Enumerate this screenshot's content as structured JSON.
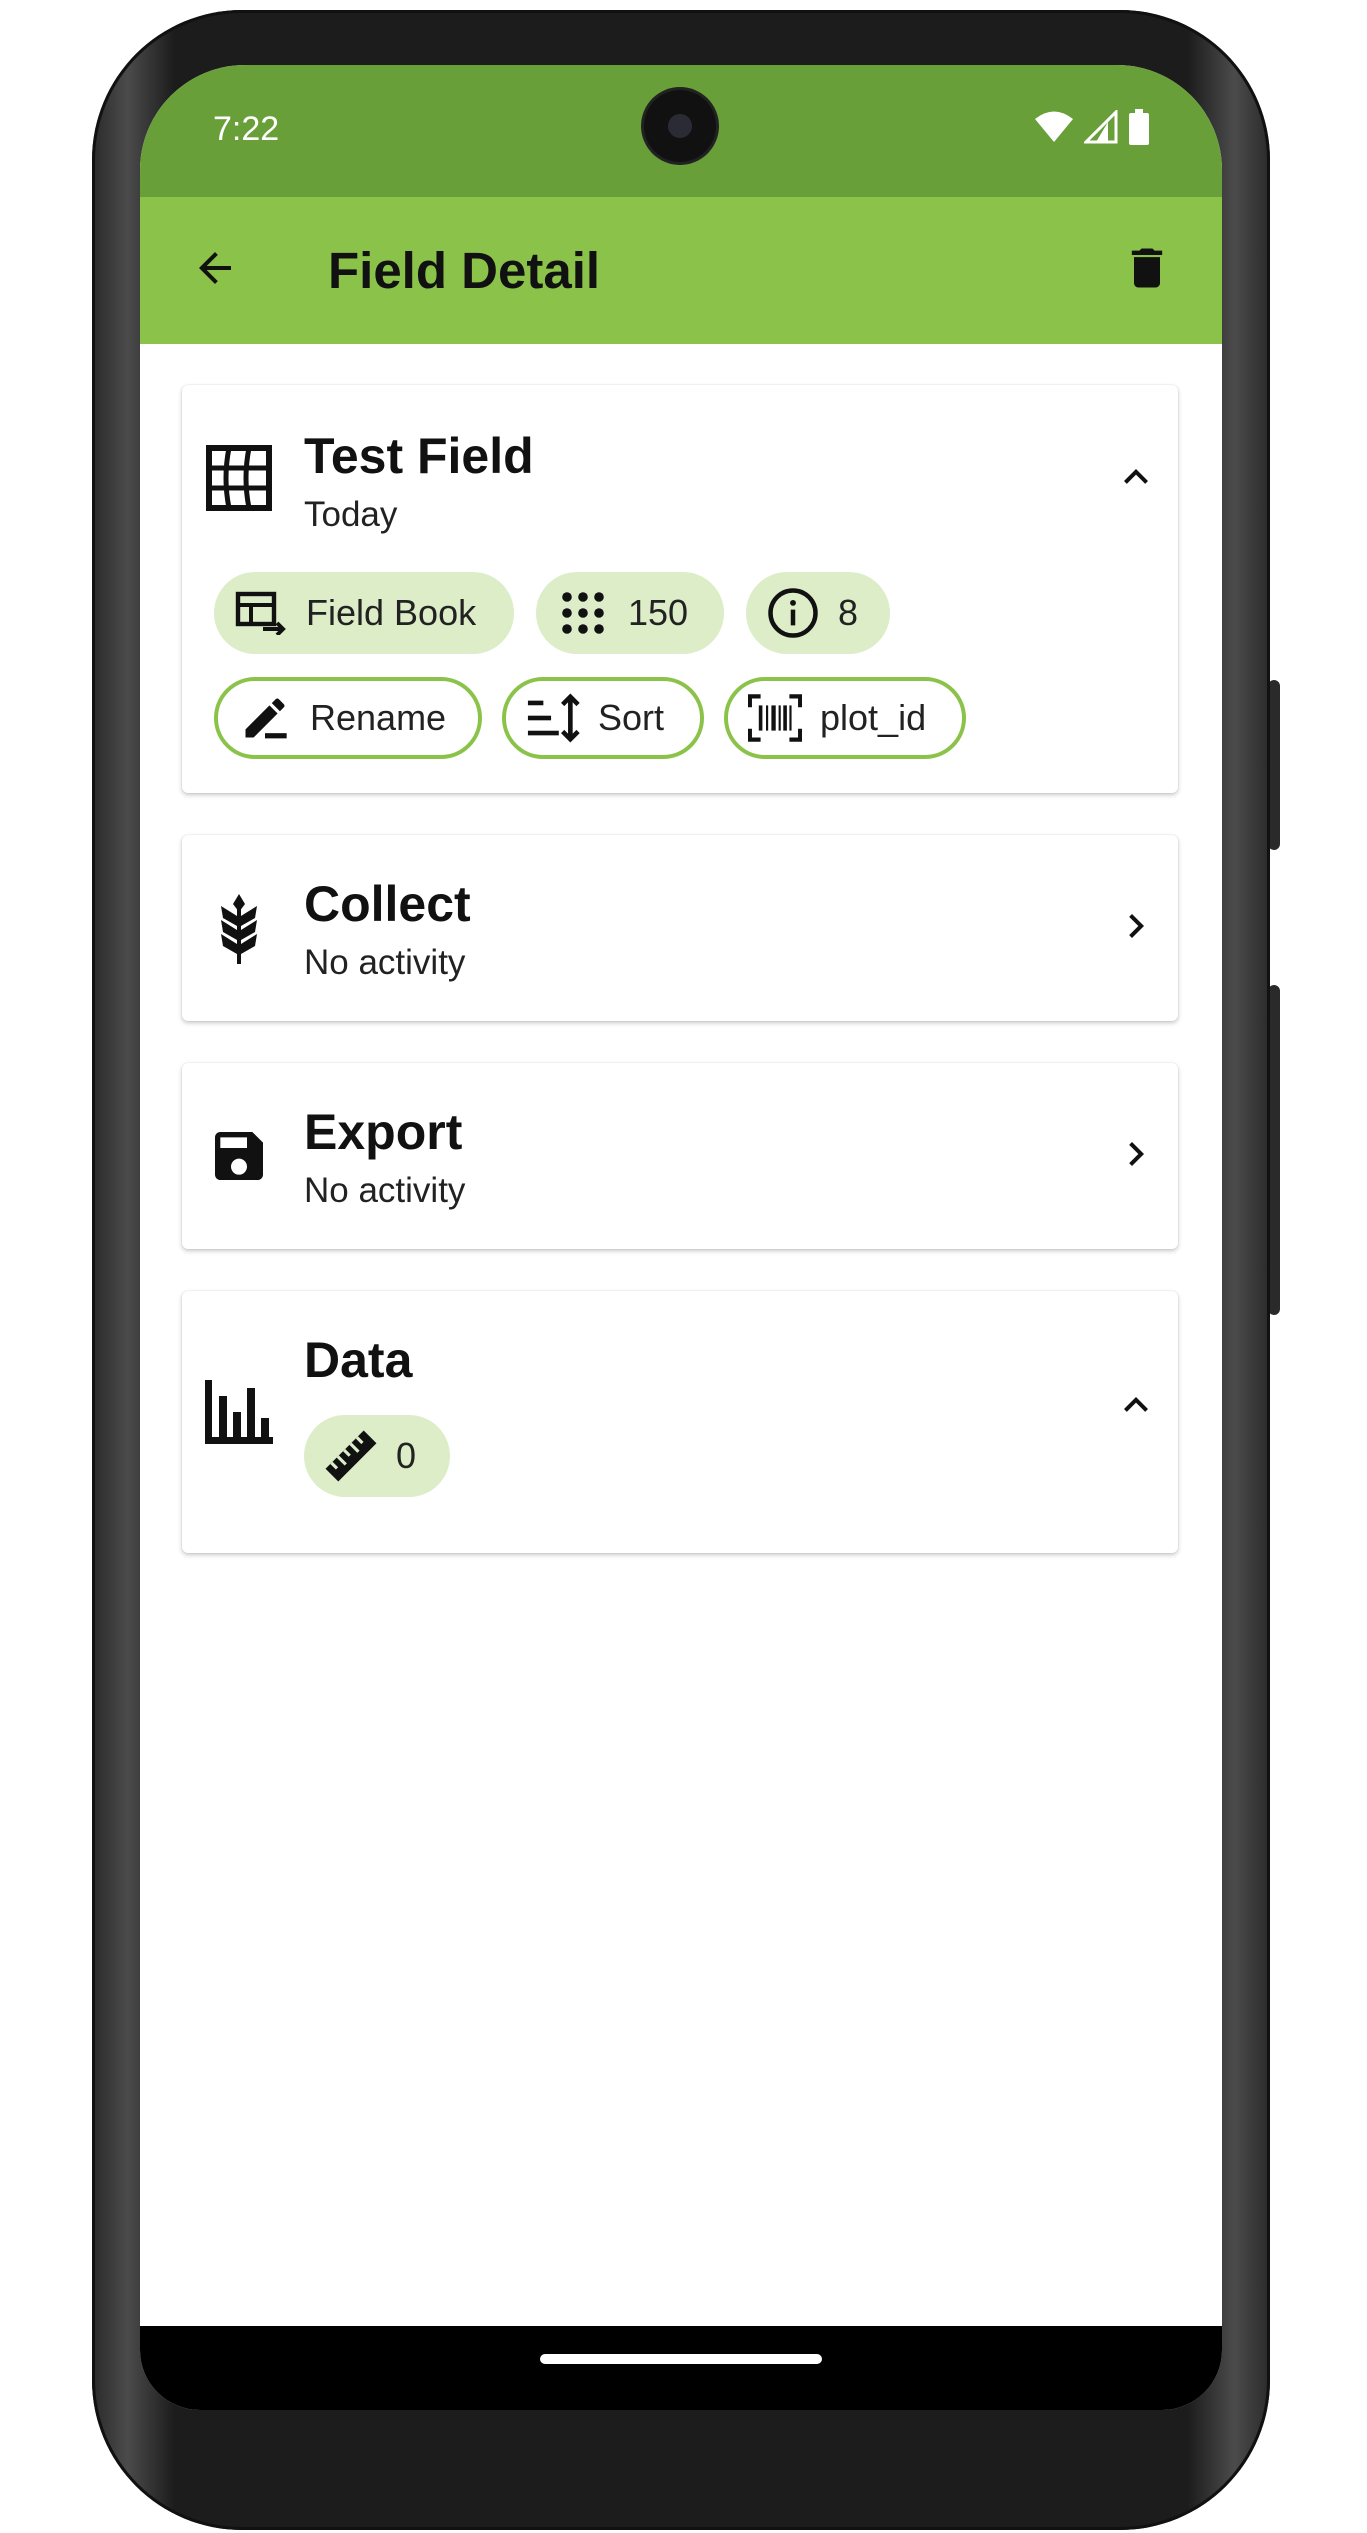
{
  "status_bar": {
    "time": "7:22",
    "icons": [
      "wifi-icon",
      "cell-signal-icon",
      "battery-icon"
    ],
    "color": "#689f38"
  },
  "toolbar": {
    "title": "Field Detail",
    "back_icon": "arrow-back-icon",
    "delete_icon": "trash-icon",
    "color": "#8bc34a"
  },
  "field_card": {
    "title": "Test Field",
    "subtitle": "Today",
    "icon": "field-grid-icon",
    "chips": [
      {
        "icon": "field-book-import-icon",
        "label": "Field Book"
      },
      {
        "icon": "dots-grid-icon",
        "label": "150"
      },
      {
        "icon": "info-icon",
        "label": "8"
      }
    ],
    "actions": [
      {
        "icon": "rename-pencil-icon",
        "label": "Rename"
      },
      {
        "icon": "sort-icon",
        "label": "Sort"
      },
      {
        "icon": "barcode-scan-icon",
        "label": "plot_id"
      }
    ]
  },
  "collect_card": {
    "title": "Collect",
    "subtitle": "No activity",
    "icon": "wheat-icon"
  },
  "export_card": {
    "title": "Export",
    "subtitle": "No activity",
    "icon": "save-floppy-icon"
  },
  "data_card": {
    "title": "Data",
    "icon": "bar-chart-icon",
    "chip": {
      "icon": "ruler-icon",
      "label": "0"
    }
  },
  "colors": {
    "chip_fill": "#dcedc8",
    "chip_outline": "#8bc34a"
  }
}
